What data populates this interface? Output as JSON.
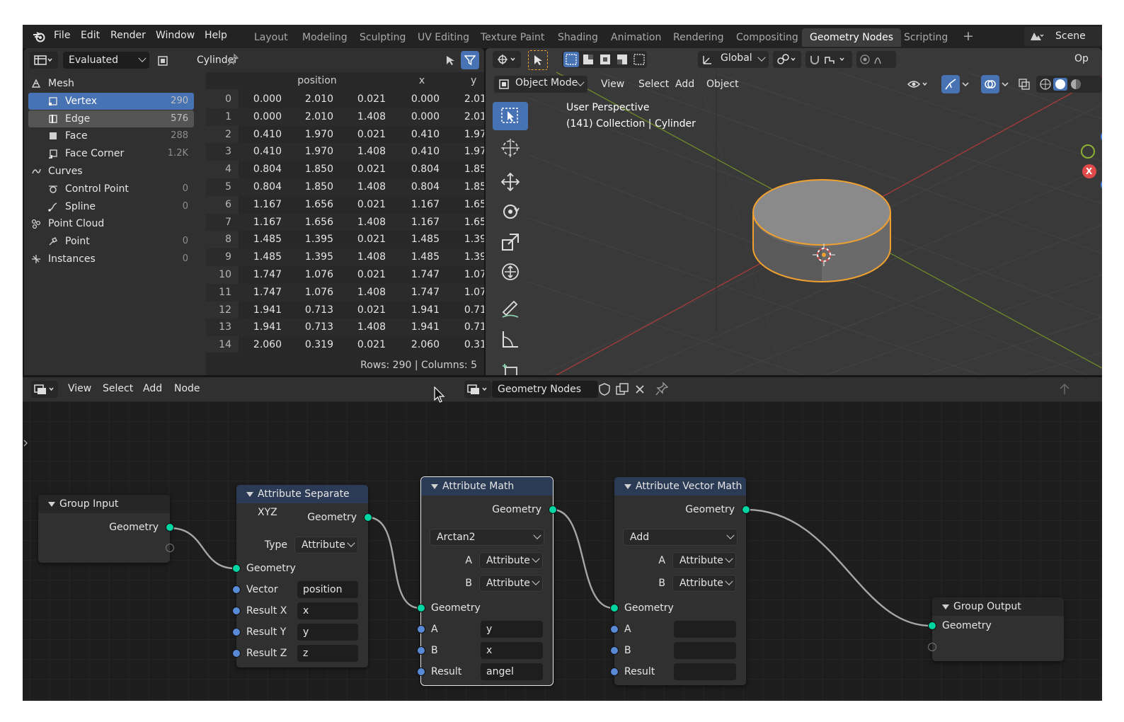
{
  "topbar": {
    "menus": [
      "File",
      "Edit",
      "Render",
      "Window",
      "Help"
    ],
    "workspaces": [
      "Layout",
      "Modeling",
      "Sculpting",
      "UV Editing",
      "Texture Paint",
      "Shading",
      "Animation",
      "Rendering",
      "Compositing",
      "Geometry Nodes",
      "Scripting"
    ],
    "active_workspace": "Geometry Nodes",
    "scene_label": "Scene",
    "plus": "+"
  },
  "spreadsheet": {
    "eval_mode": "Evaluated",
    "object_name": "Cylinder",
    "tree": [
      {
        "label": "Mesh",
        "count": "",
        "indent": 0,
        "state": "none",
        "icon": "mesh-icon"
      },
      {
        "label": "Vertex",
        "count": "290",
        "indent": 1,
        "state": "selected",
        "icon": "vertex-icon"
      },
      {
        "label": "Edge",
        "count": "576",
        "indent": 1,
        "state": "highlight",
        "icon": "edge-icon"
      },
      {
        "label": "Face",
        "count": "288",
        "indent": 1,
        "state": "none",
        "icon": "face-icon"
      },
      {
        "label": "Face Corner",
        "count": "1.2K",
        "indent": 1,
        "state": "none",
        "icon": "face-corner-icon"
      },
      {
        "label": "Curves",
        "count": "",
        "indent": 0,
        "state": "none",
        "icon": "curves-icon"
      },
      {
        "label": "Control Point",
        "count": "0",
        "indent": 1,
        "state": "none",
        "icon": "control-point-icon"
      },
      {
        "label": "Spline",
        "count": "0",
        "indent": 1,
        "state": "none",
        "icon": "spline-icon"
      },
      {
        "label": "Point Cloud",
        "count": "",
        "indent": 0,
        "state": "none",
        "icon": "point-cloud-icon"
      },
      {
        "label": "Point",
        "count": "0",
        "indent": 1,
        "state": "none",
        "icon": "point-icon"
      },
      {
        "label": "Instances",
        "count": "0",
        "indent": 0,
        "state": "none",
        "icon": "instances-icon"
      }
    ],
    "columns": [
      "position",
      "x",
      "y"
    ],
    "rows": [
      [
        "0",
        "0.000",
        "2.010",
        "0.021",
        "0.000",
        "2.01"
      ],
      [
        "1",
        "0.000",
        "2.010",
        "1.408",
        "0.000",
        "2.01"
      ],
      [
        "2",
        "0.410",
        "1.970",
        "0.021",
        "0.410",
        "1.97"
      ],
      [
        "3",
        "0.410",
        "1.970",
        "1.408",
        "0.410",
        "1.97"
      ],
      [
        "4",
        "0.804",
        "1.850",
        "0.021",
        "0.804",
        "1.85"
      ],
      [
        "5",
        "0.804",
        "1.850",
        "1.408",
        "0.804",
        "1.85"
      ],
      [
        "6",
        "1.167",
        "1.656",
        "0.021",
        "1.167",
        "1.65"
      ],
      [
        "7",
        "1.167",
        "1.656",
        "1.408",
        "1.167",
        "1.65"
      ],
      [
        "8",
        "1.485",
        "1.395",
        "0.021",
        "1.485",
        "1.39"
      ],
      [
        "9",
        "1.485",
        "1.395",
        "1.408",
        "1.485",
        "1.39"
      ],
      [
        "10",
        "1.747",
        "1.076",
        "0.021",
        "1.747",
        "1.07"
      ],
      [
        "11",
        "1.747",
        "1.076",
        "1.408",
        "1.747",
        "1.07"
      ],
      [
        "12",
        "1.941",
        "0.713",
        "0.021",
        "1.941",
        "0.71"
      ],
      [
        "13",
        "1.941",
        "0.713",
        "1.408",
        "1.941",
        "0.71"
      ],
      [
        "14",
        "2.060",
        "0.319",
        "0.021",
        "2.060",
        "0.31"
      ]
    ],
    "rows_info": "Rows: 290   |   Columns: 5"
  },
  "viewport": {
    "transform_orientation": "Global",
    "mode": "Object Mode",
    "menus": [
      "View",
      "Select",
      "Add",
      "Object"
    ],
    "info_line1": "User Perspective",
    "info_line2": "(141) Collection | Cylinder",
    "options_label": "Op",
    "gizmo_x": "X",
    "gizmo_z": "Z",
    "colors": {
      "x_axis": "#e04a4a",
      "y_axis": "#8bb030",
      "selection": "#f0a030"
    }
  },
  "node_editor": {
    "menus": [
      "View",
      "Select",
      "Add",
      "Node"
    ],
    "node_group": "Geometry Nodes",
    "nodes": {
      "group_input": {
        "title": "Group Input",
        "out_geometry": "Geometry"
      },
      "separate_xyz": {
        "title": "Attribute Separate XYZ",
        "out_geometry": "Geometry",
        "type_label": "Type",
        "type_value": "Attribute",
        "in_geometry": "Geometry",
        "vector_label": "Vector",
        "vector_value": "position",
        "rx_label": "Result X",
        "rx_value": "x",
        "ry_label": "Result Y",
        "ry_value": "y",
        "rz_label": "Result Z",
        "rz_value": "z"
      },
      "math": {
        "title": "Attribute Math",
        "out_geometry": "Geometry",
        "operation": "Arctan2",
        "a_label": "A",
        "a_type": "Attribute",
        "b_label": "B",
        "b_type": "Attribute",
        "in_geometry": "Geometry",
        "a_in": "A",
        "a_value": "y",
        "b_in": "B",
        "b_value": "x",
        "result_label": "Result",
        "result_value": "angel"
      },
      "vector_math": {
        "title": "Attribute Vector Math",
        "out_geometry": "Geometry",
        "operation": "Add",
        "a_label": "A",
        "a_type": "Attribute",
        "b_label": "B",
        "b_type": "Attribute",
        "in_geometry": "Geometry",
        "a_in": "A",
        "a_value": "",
        "b_in": "B",
        "b_value": "",
        "result_label": "Result",
        "result_value": ""
      },
      "group_output": {
        "title": "Group Output",
        "in_geometry": "Geometry"
      }
    }
  }
}
